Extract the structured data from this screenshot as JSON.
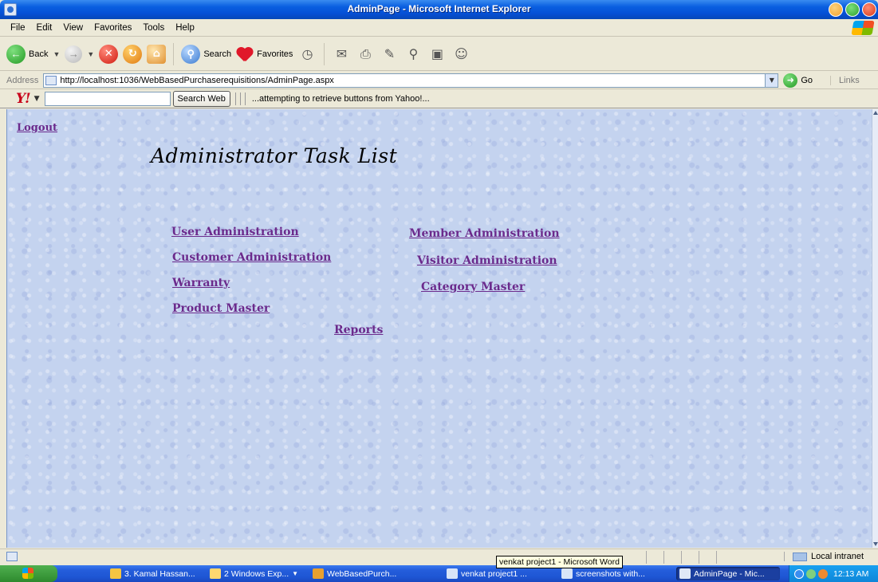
{
  "window": {
    "title": "AdminPage - Microsoft Internet Explorer"
  },
  "menu": [
    "File",
    "Edit",
    "View",
    "Favorites",
    "Tools",
    "Help"
  ],
  "toolbar": {
    "back_label": "Back",
    "search_label": "Search",
    "favorites_label": "Favorites"
  },
  "address": {
    "label": "Address",
    "url": "http://localhost:1036/WebBasedPurchaserequisitions/AdminPage.aspx",
    "go_label": "Go",
    "links_label": "Links"
  },
  "yahoo": {
    "logo": "Y!",
    "search_button": "Search Web",
    "status": "...attempting to retrieve buttons from Yahoo!..."
  },
  "page": {
    "logout": "Logout",
    "heading": "Administrator Task List",
    "links": {
      "user_admin": "User Administration",
      "customer_admin": "Customer Administration",
      "warranty": "Warranty",
      "product_master": "Product Master",
      "member_admin": "Member Administration",
      "visitor_admin": "Visitor Administration",
      "category_master": "Category Master",
      "reports": "Reports"
    }
  },
  "statusbar": {
    "zone": "Local intranet",
    "tooltip": "venkat project1 - Microsoft Word"
  },
  "taskbar": {
    "tasks": [
      "3. Kamal Hassan...",
      "2 Windows Exp...",
      "WebBasedPurch...",
      "venkat project1 ...",
      "screenshots with...",
      "AdminPage - Mic..."
    ],
    "clock": "12:13 AM"
  }
}
